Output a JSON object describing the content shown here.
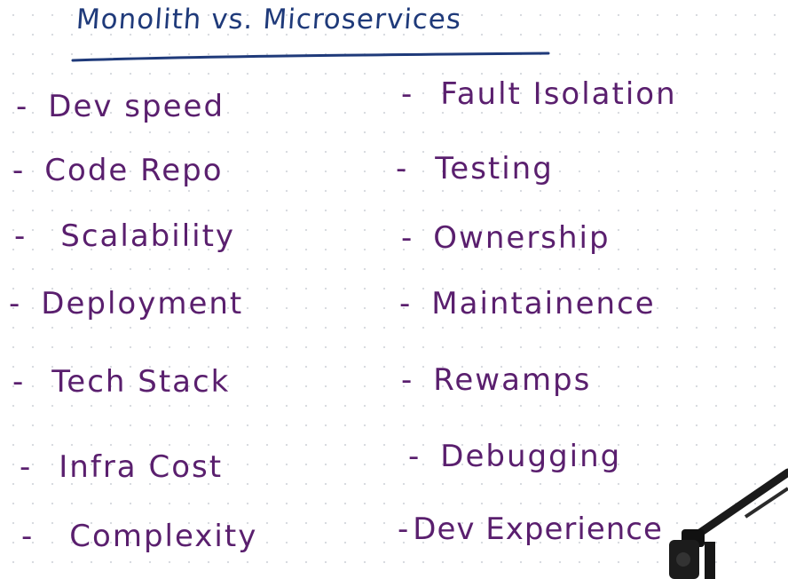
{
  "title": "Monolith  vs.  Microservices",
  "left_items": [
    {
      "dash": "-",
      "label": "Dev  speed"
    },
    {
      "dash": "-",
      "label": "Code  Repo"
    },
    {
      "dash": "-",
      "label": "Scalability"
    },
    {
      "dash": "-",
      "label": "Deployment"
    },
    {
      "dash": "-",
      "label": "Tech  Stack"
    },
    {
      "dash": "-",
      "label": "Infra  Cost"
    },
    {
      "dash": "-",
      "label": "Complexity"
    }
  ],
  "right_items": [
    {
      "dash": "-",
      "label": "Fault  Isolation"
    },
    {
      "dash": "-",
      "label": "Testing"
    },
    {
      "dash": "-",
      "label": "Ownership"
    },
    {
      "dash": "-",
      "label": "Maintainence"
    },
    {
      "dash": "-",
      "label": "Rewamps"
    },
    {
      "dash": "-",
      "label": "Debugging"
    },
    {
      "dash": "-",
      "label": "Dev  Experience"
    }
  ],
  "colors": {
    "title": "#1f3a7a",
    "ink": "#5a1f6e"
  }
}
